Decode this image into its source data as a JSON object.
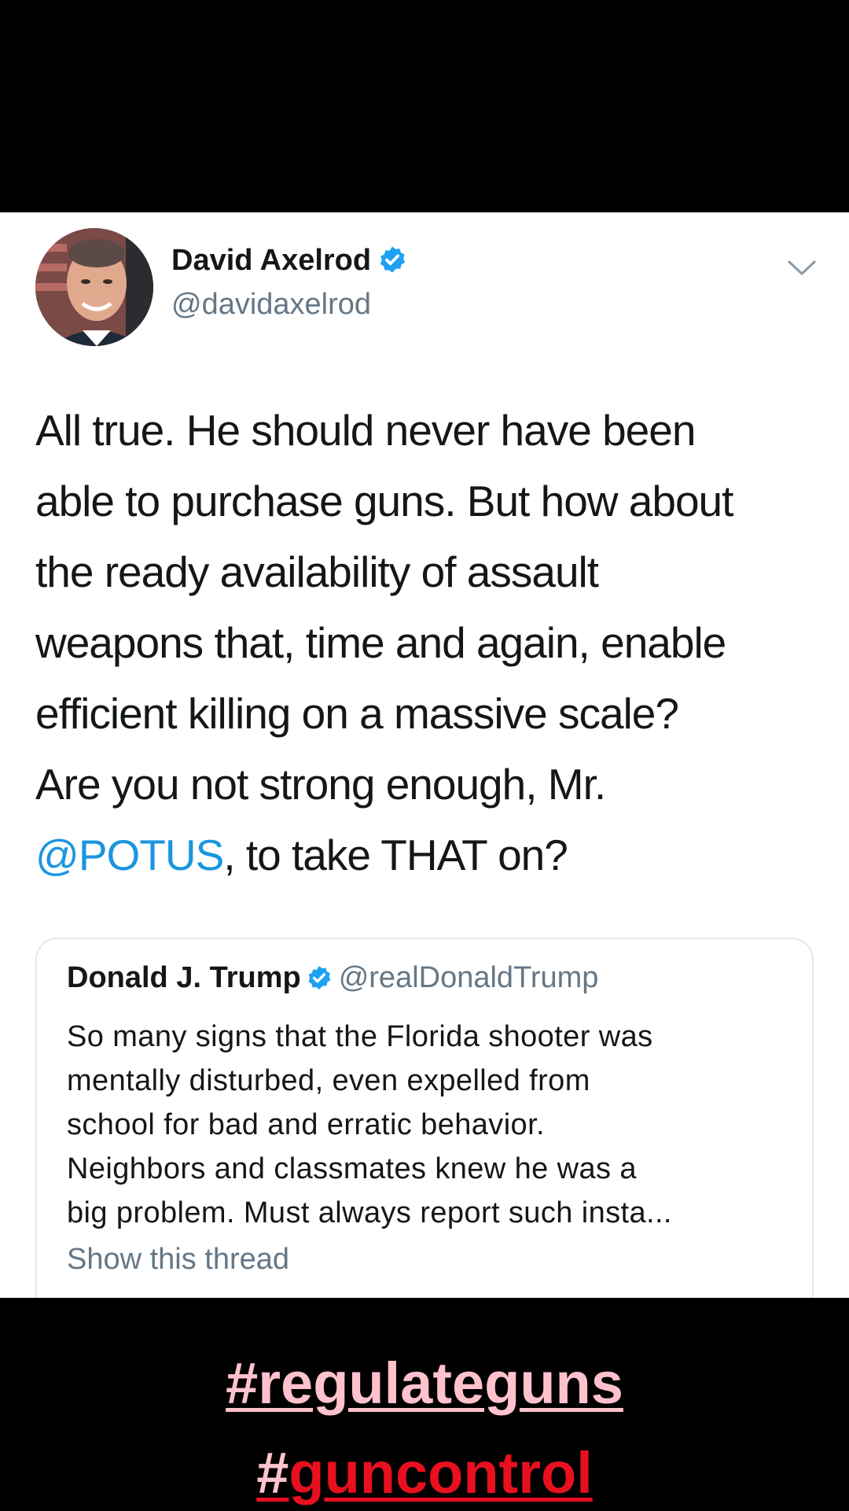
{
  "tweet": {
    "author": {
      "name": "David Axelrod",
      "handle": "@davidaxelrod",
      "verified": true,
      "avatar_icon": "profile-photo"
    },
    "menu_icon": "chevron-down-icon",
    "body_lines": [
      "All true.  He should never have been",
      "able to purchase guns. But how about",
      "the ready availability of assault",
      "weapons that, time and again, enable",
      "efficient killing on a massive scale?",
      "Are you not strong enough, Mr."
    ],
    "body_last_mention": "@POTUS",
    "body_last_rest": ", to take THAT on?",
    "quoted": {
      "name": "Donald J. Trump",
      "handle": "@realDonaldTrump",
      "verified": true,
      "text_lines": [
        "So many signs that the Florida shooter was",
        "mentally disturbed, even expelled from",
        "school for bad and erratic behavior.",
        "Neighbors and classmates knew he was a",
        "big problem. Must always report such insta..."
      ],
      "show_thread": "Show this thread"
    }
  },
  "overlay": {
    "hashtag1": "#regulateguns",
    "hashtag2_hash": "#",
    "hashtag2_rest": "guncontrol"
  },
  "colors": {
    "link_blue": "#1b95e0",
    "verified_blue": "#1da1f2",
    "muted_gray": "#657786",
    "hashtag_pink": "#ffc2cc",
    "hashtag_red": "#e8101f"
  }
}
